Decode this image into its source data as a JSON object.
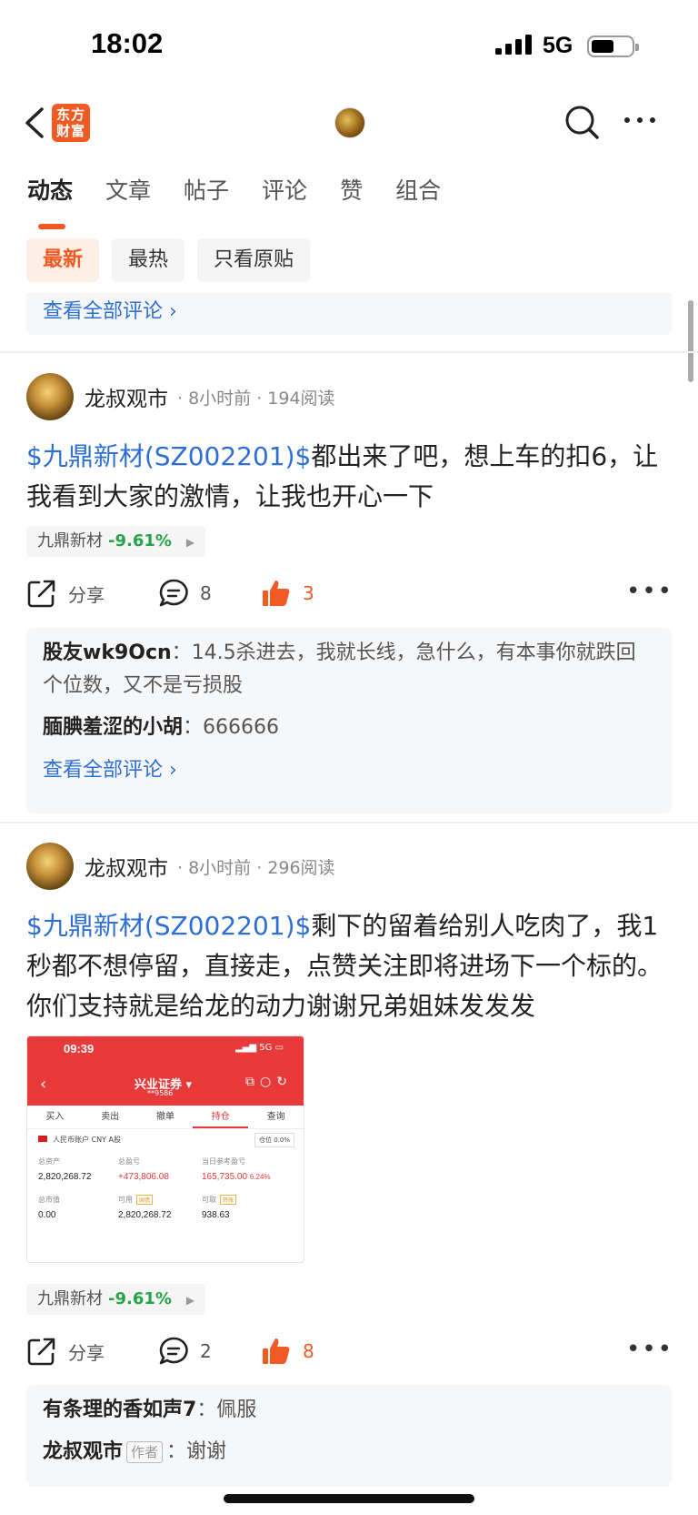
{
  "status_bar": {
    "time": "18:02",
    "network": "5G"
  },
  "nav": {
    "app_logo_line1": "东方",
    "app_logo_line2": "财富"
  },
  "tabs": [
    "动态",
    "文章",
    "帖子",
    "评论",
    "赞",
    "组合"
  ],
  "filters": [
    "最新",
    "最热",
    "只看原贴"
  ],
  "top_box": {
    "view_all": "查看全部评论"
  },
  "posts": [
    {
      "author": "龙叔观市",
      "meta": "· 8小时前 · 194阅读",
      "stock_link": "$九鼎新材(SZ002201)$",
      "text": "都出来了吧，想上车的扣6，让我看到大家的激情，让我也开心一下",
      "tag_name": "九鼎新材",
      "tag_change": "-9.61%",
      "share": "分享",
      "comments": "8",
      "likes": "3",
      "comment_list": [
        {
          "user": "股友wk9Ocn",
          "text": "14.5杀进去，我就长线，急什么，有本事你就跌回个位数，又不是亏损股"
        },
        {
          "user": "腼腆羞涩的小胡",
          "text": "666666"
        }
      ],
      "view_all": "查看全部评论"
    },
    {
      "author": "龙叔观市",
      "meta": "· 8小时前 · 296阅读",
      "stock_link": "$九鼎新材(SZ002201)$",
      "text": "剩下的留着给别人吃肉了，我1秒都不想停留，直接走，点赞关注即将进场下一个标的。你们支持就是给龙的动力谢谢兄弟姐妹发发发",
      "tag_name": "九鼎新材",
      "tag_change": "-9.61%",
      "share": "分享",
      "comments": "2",
      "likes": "8",
      "comment_list": [
        {
          "user": "有条理的香如声7",
          "text": "佩服"
        },
        {
          "user": "龙叔观市",
          "badge": "作者",
          "text": "谢谢"
        }
      ],
      "image": {
        "time": "09:39",
        "status": "5G",
        "title": "兴业证券",
        "account": "**9586",
        "tabs": [
          "买入",
          "卖出",
          "撤单",
          "持仓",
          "查询"
        ],
        "account_line": "人民币账户 CNY A股",
        "position": "仓位 0.0%",
        "labels": [
          "总资产",
          "总盈亏",
          "当日参考盈亏",
          "总市值",
          "可用",
          "可取"
        ],
        "values": [
          "2,820,268.72",
          "+473,806.08",
          "165,735.00",
          "0.00",
          "2,820,268.72",
          "938.63"
        ],
        "pct": "6.24%",
        "mini1": "国债",
        "mini2": "转账"
      }
    }
  ]
}
